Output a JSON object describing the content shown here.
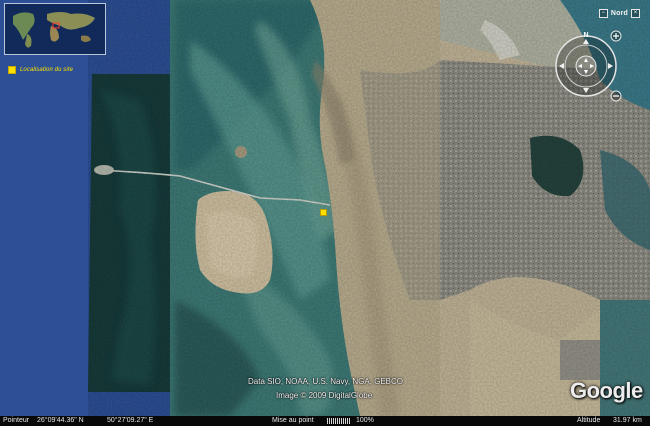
{
  "inset_map": {
    "icon": "world-overview-map"
  },
  "legend": {
    "label": "Localisation du site",
    "marker_color": "#ffe100"
  },
  "window_controls": {
    "minimize": "−",
    "label": "Nord",
    "close": "×"
  },
  "navigation": {
    "north_label": "N",
    "icons": [
      "look-joystick",
      "move-joystick",
      "zoom-in",
      "zoom-out"
    ]
  },
  "credits": {
    "line1": "Data SIO, NOAA, U.S. Navy, NGA, GEBCO",
    "line2": "Image © 2009 DigitalGlobe"
  },
  "brand": {
    "logo_text": "Google"
  },
  "status_bar": {
    "pointer_label": "Pointeur",
    "latitude": "26°09'44.36\" N",
    "longitude": "50°27'09.27\" E",
    "streaming_label": "Mise au point",
    "streaming_percent": "100%",
    "streaming_progress": 1.0,
    "altitude_label": "Altitude",
    "altitude_value": "31.97 km"
  },
  "colors": {
    "sea_deep": "#1f3f7e",
    "shallow_water": "#5e9c93",
    "land": "#b9ad8f",
    "urban": "#7f7e77",
    "site_marker": "#ffe100"
  }
}
